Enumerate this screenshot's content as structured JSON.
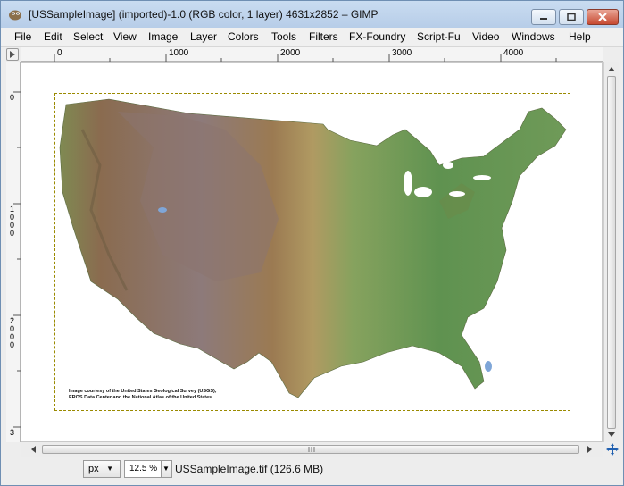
{
  "window": {
    "title": "[USSampleImage] (imported)-1.0 (RGB color, 1 layer) 4631x2852 – GIMP"
  },
  "menu": [
    {
      "label": "File"
    },
    {
      "label": "Edit"
    },
    {
      "label": "Select"
    },
    {
      "label": "View"
    },
    {
      "label": "Image"
    },
    {
      "label": "Layer"
    },
    {
      "label": "Colors"
    },
    {
      "label": "Tools"
    },
    {
      "label": "Filters"
    },
    {
      "label": "FX-Foundry"
    },
    {
      "label": "Script-Fu"
    },
    {
      "label": "Video"
    },
    {
      "label": "Windows"
    },
    {
      "label": "Help"
    }
  ],
  "ruler": {
    "h_ticks": [
      "0",
      "1000",
      "2000",
      "3000",
      "4000"
    ],
    "v_ticks": [
      "0",
      "1000",
      "2000",
      "3"
    ]
  },
  "image": {
    "credit_line1": "Image courtesy of the United States Geological Survey (USGS),",
    "credit_line2": "EROS Data Center and the National Atlas of the United States."
  },
  "status": {
    "unit": "px",
    "zoom": "12.5 %",
    "file_info": "USSampleImage.tif (126.6 MB)"
  },
  "colors": {
    "titlebar": "#c3d7ee",
    "selection": "#9a8a00",
    "terrain_green": "#6e9a52",
    "terrain_brown": "#8a6a4a"
  }
}
